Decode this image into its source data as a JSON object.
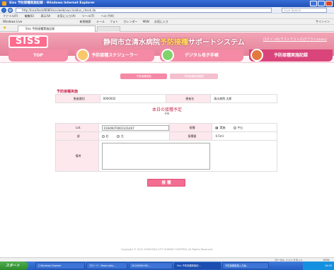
{
  "window": {
    "title": "Siss 予防接種実施記録 - Windows Internet Explorer"
  },
  "browser": {
    "address": "http://localhost/8080/siss/web/vaccination_check.do",
    "search_placeholder": "Live Search",
    "menu": [
      "ファイル(F)",
      "編集(E)",
      "表示(V)",
      "お気に入り(A)",
      "ツール(T)",
      "ヘルプ(H)"
    ],
    "links_left": "Windows Live",
    "links_right": "サインイン",
    "toolbar_items": [
      "新規検索",
      "メール",
      "フォト",
      "カレンダー",
      "MSN",
      "お気に入り"
    ],
    "tab_label": "Siss 予防接種実施記録",
    "cmdbar": "ページ(P) ▾ ツール(O) ▾"
  },
  "app": {
    "logo": "SISS",
    "system_title_1": "静岡市立清水病院",
    "system_title_2": "予防接種",
    "system_title_3": "サポートシステム",
    "logout": "ログインID:テストテスト/ログアウト(main)",
    "nav": {
      "top": "TOP",
      "schedule": "予防接種スケジューラー",
      "book": "デジタル母子手帳",
      "record": "予防接種実施記録"
    },
    "subtabs": [
      "予防接種実施",
      "予防接種実施履歴"
    ]
  },
  "main": {
    "section_title": "予防接種実施",
    "patient": {
      "id_label": "患者識別",
      "id_value": "0000002",
      "name_label": "患者名",
      "name_value": "清水病院 太郎"
    },
    "today_title": "本日の接種予定",
    "vaccine_name": "Hib",
    "form": {
      "lot_label": "Lot.",
      "lot_value": "01049070001101407",
      "injection_label": "接種",
      "injection_options": [
        "実施",
        "中止"
      ],
      "injection_selected": "実施",
      "part_label": "部",
      "part_options": [
        "右",
        "左"
      ],
      "dose_label": "接種量",
      "dose_value": "0.5ml",
      "note_label": "備考",
      "note_value": ""
    },
    "submit_label": "接 種"
  },
  "footer": "Copyright © 2012 SHIZUOKA CITY SHIMIZU HOSPITAL All Rights Reserved.",
  "status": {
    "zone": "ローカル イントラネット",
    "zoom": "100%"
  },
  "taskbar": {
    "start": "スタート",
    "items": [
      "2 Windows Explorer",
      "マロード - Reservatio...",
      "20140609-ISS-...",
      "Siss 予防接種実施記...",
      "予防接種実施入力画..."
    ],
    "clock": "16:05"
  }
}
